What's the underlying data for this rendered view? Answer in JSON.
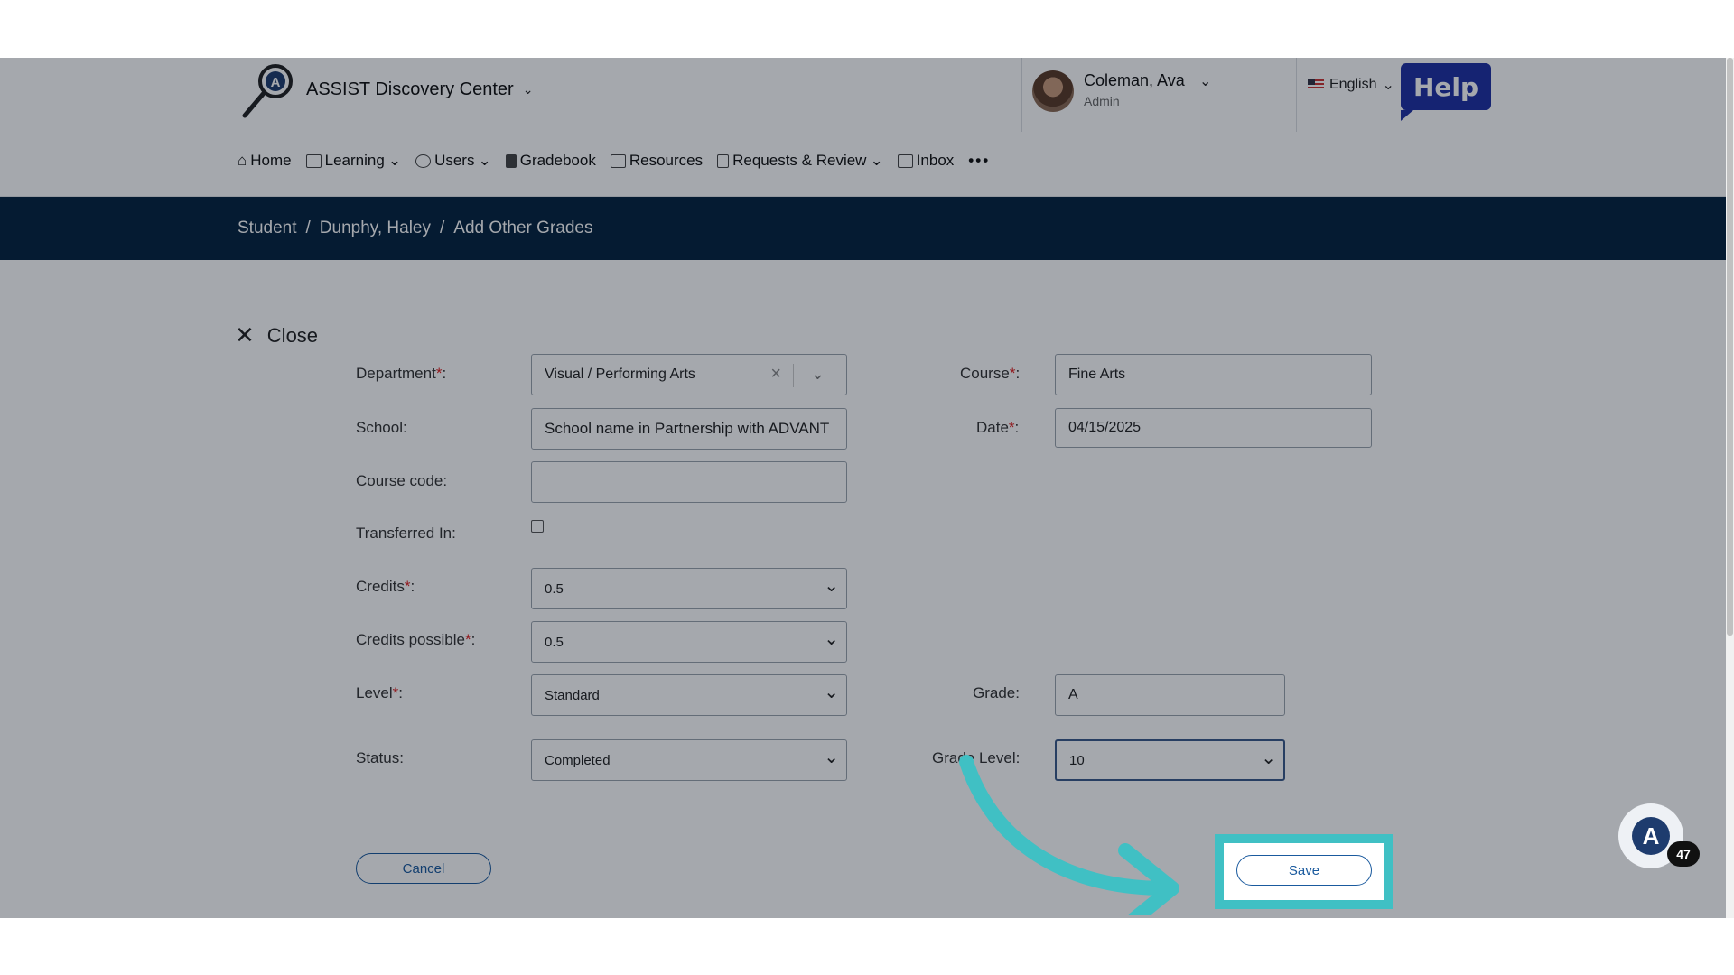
{
  "header": {
    "app_title": "ASSIST Discovery Center",
    "user_name": "Coleman, Ava",
    "user_role": "Admin",
    "language": "English",
    "help_label": "Help"
  },
  "nav": {
    "items": [
      {
        "label": "Home",
        "icon": "home-icon"
      },
      {
        "label": "Learning",
        "icon": "learning-icon",
        "dropdown": true
      },
      {
        "label": "Users",
        "icon": "users-icon",
        "dropdown": true
      },
      {
        "label": "Gradebook",
        "icon": "gradebook-icon"
      },
      {
        "label": "Resources",
        "icon": "resources-icon"
      },
      {
        "label": "Requests & Review",
        "icon": "requests-icon",
        "dropdown": true
      },
      {
        "label": "Inbox",
        "icon": "inbox-icon"
      }
    ],
    "more": "•••"
  },
  "breadcrumb": {
    "items": [
      "Student",
      "Dunphy, Haley",
      "Add Other Grades"
    ],
    "separator": "/"
  },
  "form": {
    "close_label": "Close",
    "department": {
      "label": "Department",
      "value": "Visual / Performing Arts"
    },
    "school": {
      "label": "School",
      "value": "School name in Partnership with ADVANT"
    },
    "course_code": {
      "label": "Course code",
      "value": ""
    },
    "transferred_in": {
      "label": "Transferred In",
      "checked": false
    },
    "credits": {
      "label": "Credits",
      "value": "0.5"
    },
    "credits_possible": {
      "label": "Credits possible",
      "value": "0.5"
    },
    "level": {
      "label": "Level",
      "value": "Standard"
    },
    "status": {
      "label": "Status",
      "value": "Completed"
    },
    "course": {
      "label": "Course",
      "value": "Fine Arts"
    },
    "date": {
      "label": "Date",
      "value": "04/15/2025"
    },
    "grade": {
      "label": "Grade",
      "value": "A"
    },
    "grade_level": {
      "label": "Grade Level",
      "value": "10"
    },
    "cancel_label": "Cancel",
    "save_label": "Save"
  },
  "chat": {
    "badge_count": "47"
  },
  "colors": {
    "nav_bar": "#06233f",
    "highlight": "#40c0c4",
    "help_button": "#1e2fa3",
    "button_outline": "#1a5a9e"
  }
}
